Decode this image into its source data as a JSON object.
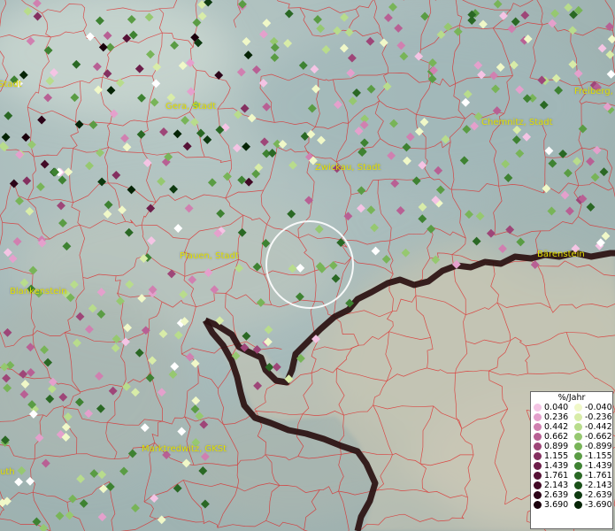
{
  "map": {
    "place_labels": [
      {
        "id": "stadt-left",
        "text": "Stadt"
      },
      {
        "id": "gera",
        "text": "Gera, Stadt"
      },
      {
        "id": "freiberg",
        "text": "Freiberg,"
      },
      {
        "id": "chemnitz",
        "text": "Chemnitz, Stadt"
      },
      {
        "id": "zwickau",
        "text": "Zwickau, Stadt"
      },
      {
        "id": "plauen",
        "text": "Plauen, Stadt"
      },
      {
        "id": "barenstein",
        "text": "Bärenstein"
      },
      {
        "id": "blankenstein",
        "text": "Blankenstein"
      },
      {
        "id": "marktredwitz",
        "text": "Marktredwitz, GKSt"
      },
      {
        "id": "uth",
        "text": "uth"
      }
    ],
    "colors": {
      "district_borders": "#e02020",
      "national_border": "#2a1010",
      "label_color": "#e3e000",
      "selection_circle": "#ffffff"
    }
  },
  "legend": {
    "title": "%/Jahr",
    "positive": [
      {
        "label": "0.040",
        "color": "#f4c4e4"
      },
      {
        "label": "0.236",
        "color": "#e4a0cc"
      },
      {
        "label": "0.442",
        "color": "#d080b0"
      },
      {
        "label": "0.662",
        "color": "#b86094"
      },
      {
        "label": "0.899",
        "color": "#9e4678"
      },
      {
        "label": "1.155",
        "color": "#843060"
      },
      {
        "label": "1.439",
        "color": "#6c1e4a"
      },
      {
        "label": "1.761",
        "color": "#561236"
      },
      {
        "label": "2.143",
        "color": "#420a26"
      },
      {
        "label": "2.639",
        "color": "#2c0418"
      },
      {
        "label": "3.690",
        "color": "#1a000c"
      }
    ],
    "negative": [
      {
        "label": "-0.040",
        "color": "#f0f8c8"
      },
      {
        "label": "-0.236",
        "color": "#d8eca8"
      },
      {
        "label": "-0.442",
        "color": "#b8dc8c"
      },
      {
        "label": "-0.662",
        "color": "#96c870"
      },
      {
        "label": "-0.899",
        "color": "#78b458"
      },
      {
        "label": "-1.155",
        "color": "#5a9c44"
      },
      {
        "label": "-1.439",
        "color": "#3e8232"
      },
      {
        "label": "-1.761",
        "color": "#2a6824"
      },
      {
        "label": "-2.143",
        "color": "#1a5018"
      },
      {
        "label": "-2.639",
        "color": "#0e3a10"
      },
      {
        "label": "-3.690",
        "color": "#062406"
      }
    ]
  }
}
